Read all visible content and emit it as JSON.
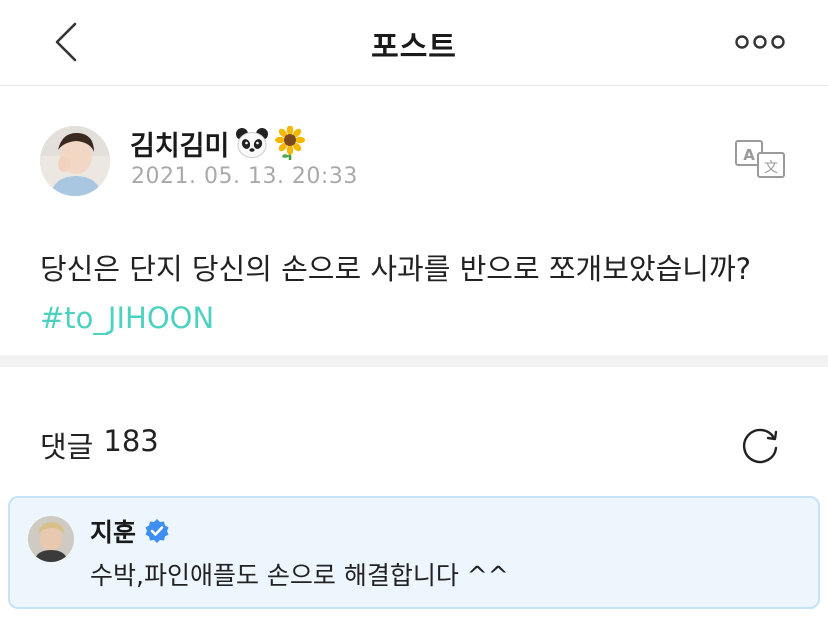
{
  "header": {
    "title": "포스트",
    "back_icon": "chevron-left-icon",
    "more_icon": "more-horizontal-icon"
  },
  "post": {
    "author": "김치김미",
    "author_emojis": [
      "panda-face-icon",
      "sunflower-icon"
    ],
    "date": "2021. 05. 13. 20:33",
    "body": "당신은 단지 당신의 손으로 사과를 반으로 쪼개보았습니까?",
    "hashtag": "#to_JIHOON",
    "translate_icon": "translate-icon"
  },
  "comments": {
    "label": "댓글",
    "count": "183",
    "refresh_icon": "refresh-icon"
  },
  "pinned_comment": {
    "author": "지훈",
    "verified_icon": "verified-badge-icon",
    "text": "수박,파인애플도 손으로 해결합니다 ^^"
  },
  "colors": {
    "hashtag": "#4fd1c0",
    "date": "#a9a9a9",
    "pinned_bg": "#eef6fd",
    "pinned_border": "#c6e2f7",
    "verified": "#3d8ff0"
  }
}
